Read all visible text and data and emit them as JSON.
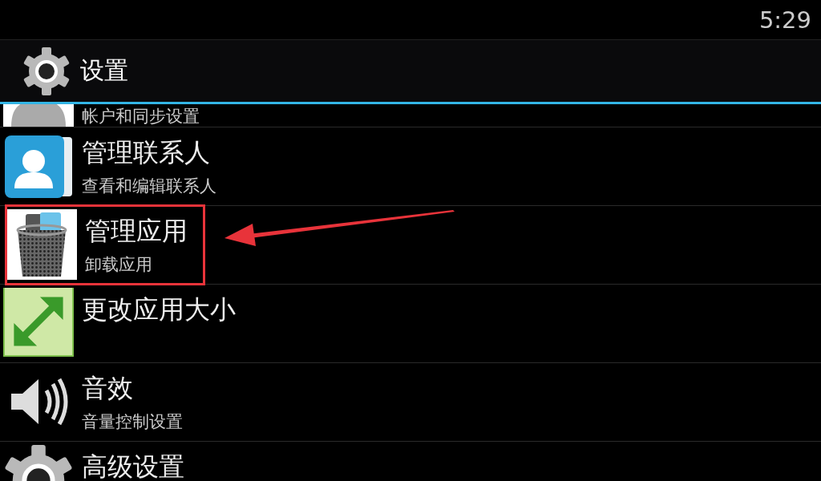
{
  "status_bar": {
    "time": "5:29"
  },
  "action_bar": {
    "title": "设置"
  },
  "rows": [
    {
      "kind": "account",
      "subtitle": "帐户和同步设置",
      "highlighted": false
    },
    {
      "kind": "contacts",
      "title": "管理联系人",
      "subtitle": "查看和编辑联系人",
      "highlighted": false
    },
    {
      "kind": "apps",
      "title": "管理应用",
      "subtitle": "卸载应用",
      "highlighted": true
    },
    {
      "kind": "resize",
      "title": "更改应用大小",
      "highlighted": false
    },
    {
      "kind": "sound",
      "title": "音效",
      "subtitle": "音量控制设置",
      "highlighted": false
    },
    {
      "kind": "advanced",
      "title": "高级设置",
      "highlighted": false
    }
  ]
}
